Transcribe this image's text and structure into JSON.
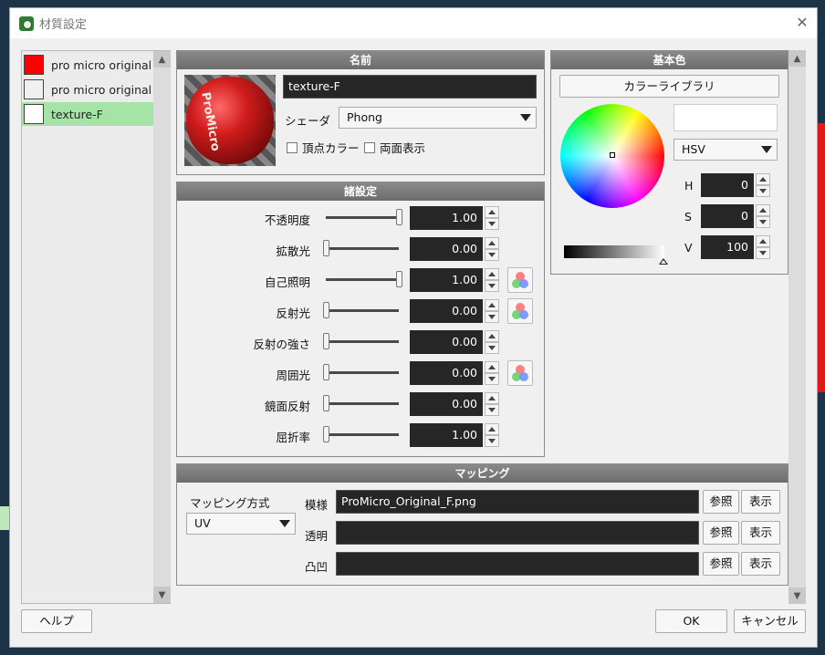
{
  "window": {
    "title": "材質設定",
    "close_glyph": "✕"
  },
  "materials": [
    {
      "label": "pro micro original r",
      "color": "#ff0000",
      "selected": false
    },
    {
      "label": "pro micro original s",
      "color": "#f0f0f0",
      "selected": false
    },
    {
      "label": "texture-F",
      "color": "#ffffff",
      "selected": true
    }
  ],
  "name_panel": {
    "header": "名前",
    "name_value": "texture-F",
    "shader_label": "シェーダ",
    "shader_value": "Phong",
    "vertex_color_label": "頂点カラー",
    "double_sided_label": "両面表示",
    "preview_text": "ProMicro"
  },
  "settings_panel": {
    "header": "諸設定",
    "rows": [
      {
        "label": "不透明度",
        "value": "1.00",
        "level": 1.0,
        "has_mix": false
      },
      {
        "label": "拡散光",
        "value": "0.00",
        "level": 0.0,
        "has_mix": false
      },
      {
        "label": "自己照明",
        "value": "1.00",
        "level": 1.0,
        "has_mix": true
      },
      {
        "label": "反射光",
        "value": "0.00",
        "level": 0.0,
        "has_mix": true
      },
      {
        "label": "反射の強さ",
        "value": "0.00",
        "level": 0.0,
        "has_mix": false
      },
      {
        "label": "周囲光",
        "value": "0.00",
        "level": 0.0,
        "has_mix": true
      },
      {
        "label": "鏡面反射",
        "value": "0.00",
        "level": 0.0,
        "has_mix": false
      },
      {
        "label": "屈折率",
        "value": "1.00",
        "level": 0.0,
        "has_mix": false
      }
    ]
  },
  "base_color_panel": {
    "header": "基本色",
    "library_button": "カラーライブラリ",
    "mode_value": "HSV",
    "preview_color": "#ffffff",
    "h_label": "H",
    "h_value": "0",
    "s_label": "S",
    "s_value": "0",
    "v_label": "V",
    "v_value": "100"
  },
  "mapping_panel": {
    "header": "マッピング",
    "method_label": "マッピング方式",
    "method_value": "UV",
    "rows": [
      {
        "label": "模様",
        "value": "ProMicro_Original_F.png",
        "browse": "参照",
        "show": "表示"
      },
      {
        "label": "透明",
        "value": "",
        "browse": "参照",
        "show": "表示"
      },
      {
        "label": "凸凹",
        "value": "",
        "browse": "参照",
        "show": "表示"
      }
    ]
  },
  "footer": {
    "help_button": "ヘルプ",
    "ok_button": "OK",
    "cancel_button": "キャンセル"
  }
}
